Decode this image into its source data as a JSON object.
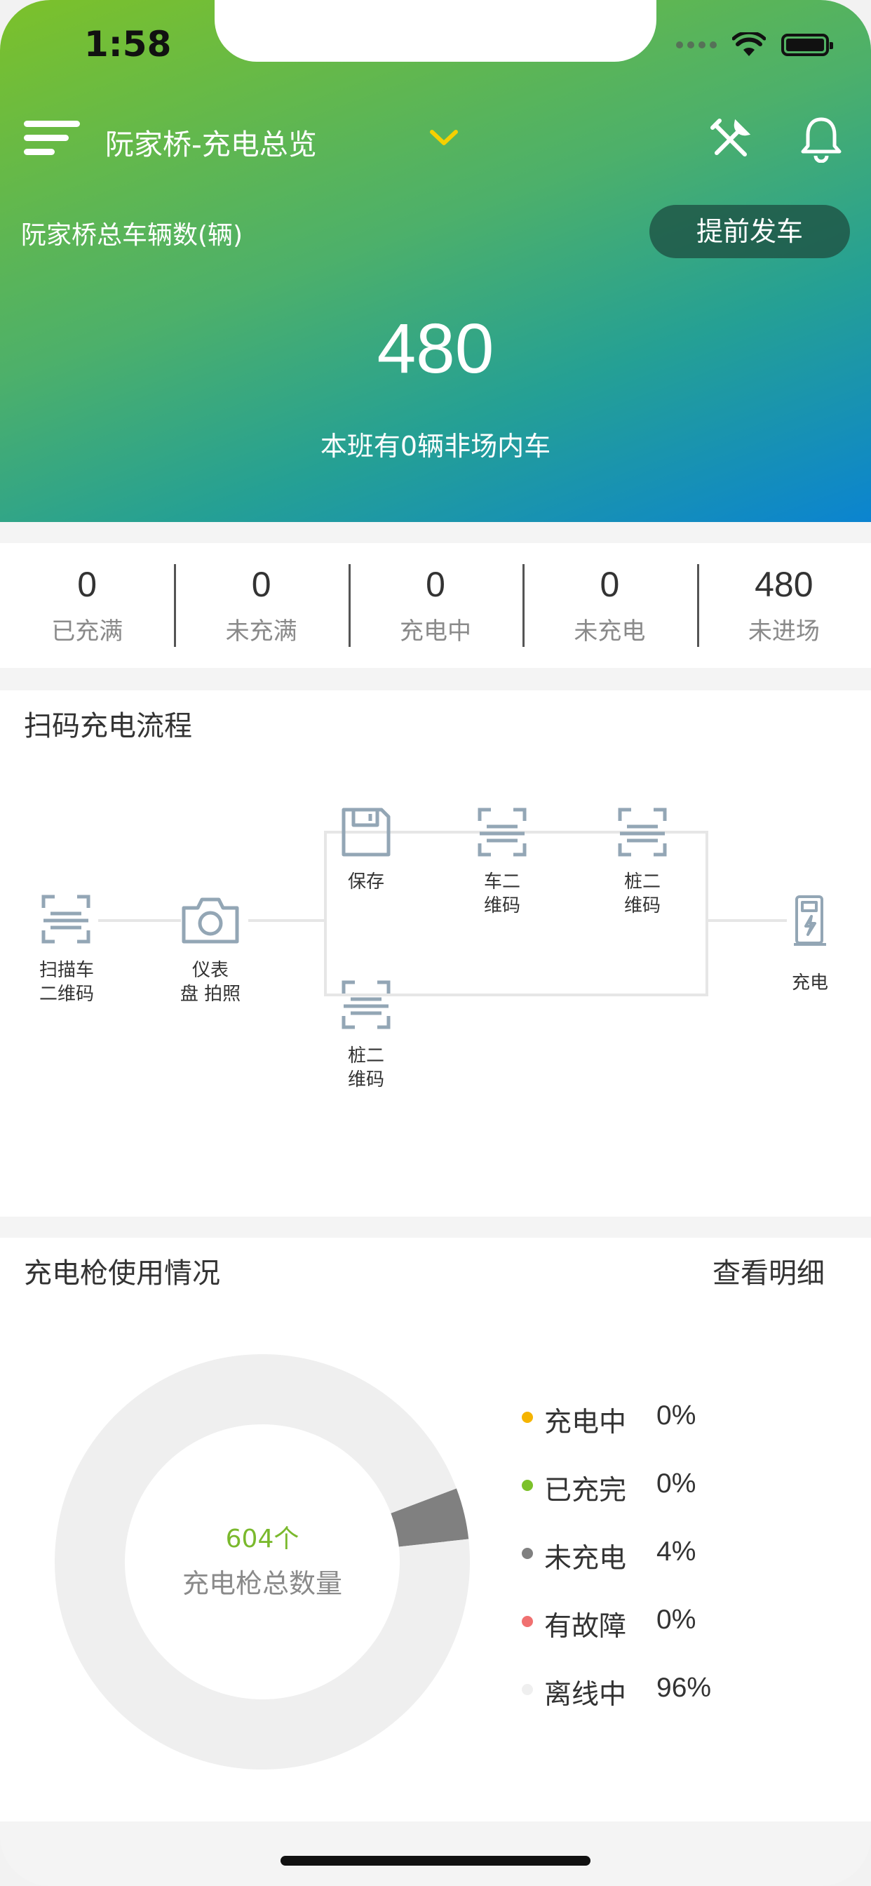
{
  "status_bar": {
    "time": "1:58"
  },
  "header": {
    "title": "阮家桥-充电总览",
    "total_label": "阮家桥总车辆数(辆)",
    "early_departure_button": "提前发车",
    "total_vehicles": "480",
    "note": "本班有0辆非场内车"
  },
  "stats": [
    {
      "value": "0",
      "label": "已充满"
    },
    {
      "value": "0",
      "label": "未充满"
    },
    {
      "value": "0",
      "label": "充电中"
    },
    {
      "value": "0",
      "label": "未充电"
    },
    {
      "value": "480",
      "label": "未进场"
    }
  ],
  "process": {
    "title": "扫码充电流程",
    "steps": {
      "scan_vehicle": [
        "扫描车",
        "二维码"
      ],
      "dashboard_photo": [
        "仪表",
        "盘 拍照"
      ],
      "save": [
        "保存"
      ],
      "vehicle_qr": [
        "车二",
        "维码"
      ],
      "pile_qr_top": [
        "桩二",
        "维码"
      ],
      "pile_qr_bottom": [
        "桩二",
        "维码"
      ],
      "charge": [
        "充电"
      ]
    },
    "icons": {
      "scan_vehicle": "qr-scan-icon",
      "dashboard_photo": "camera-icon",
      "save": "save-icon",
      "vehicle_qr": "qr-scan-icon",
      "pile_qr_top": "qr-scan-icon",
      "pile_qr_bottom": "qr-scan-icon",
      "charge": "charging-pile-icon"
    }
  },
  "usage": {
    "title": "充电枪使用情况",
    "detail_link": "查看明细",
    "total_guns": "604个",
    "total_label": "充电枪总数量",
    "legend": [
      {
        "name": "充电中",
        "value": "0%",
        "color": "#f5b400"
      },
      {
        "name": "已充完",
        "value": "0%",
        "color": "#7cc12a"
      },
      {
        "name": "未充电",
        "value": "4%",
        "color": "#808080"
      },
      {
        "name": "有故障",
        "value": "0%",
        "color": "#f07070"
      },
      {
        "name": "离线中",
        "value": "96%",
        "color": "#efefef"
      }
    ]
  },
  "chart_data": {
    "type": "pie",
    "categories": [
      "充电中",
      "已充完",
      "未充电",
      "有故障",
      "离线中"
    ],
    "values": [
      0,
      0,
      4,
      0,
      96
    ],
    "colors": [
      "#f5b400",
      "#7cc12a",
      "#808080",
      "#f07070",
      "#efefef"
    ]
  }
}
